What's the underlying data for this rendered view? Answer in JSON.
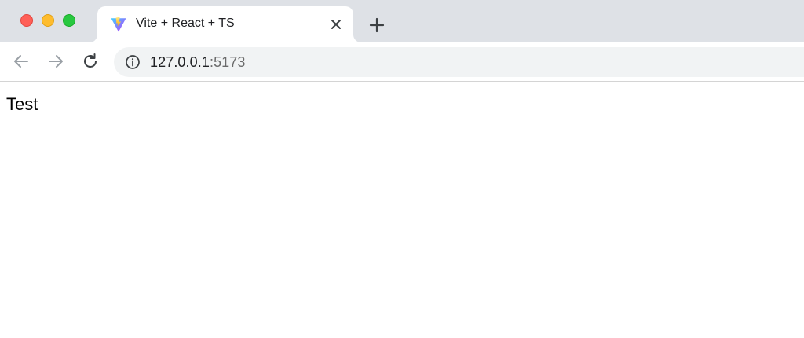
{
  "window": {
    "controls": [
      "close",
      "minimize",
      "maximize"
    ],
    "colors": {
      "close": "#ff5f57",
      "minimize": "#febc2e",
      "maximize": "#28c840"
    }
  },
  "tab": {
    "title": "Vite + React + TS",
    "favicon": "vite-logo-icon",
    "close_icon": "close-icon"
  },
  "new_tab_icon": "plus-icon",
  "toolbar": {
    "back_icon": "arrow-left-icon",
    "forward_icon": "arrow-right-icon",
    "reload_icon": "reload-icon",
    "site_info_icon": "info-icon"
  },
  "address_bar": {
    "host": "127.0.0.1",
    "port": ":5173"
  },
  "page": {
    "text": "Test"
  }
}
